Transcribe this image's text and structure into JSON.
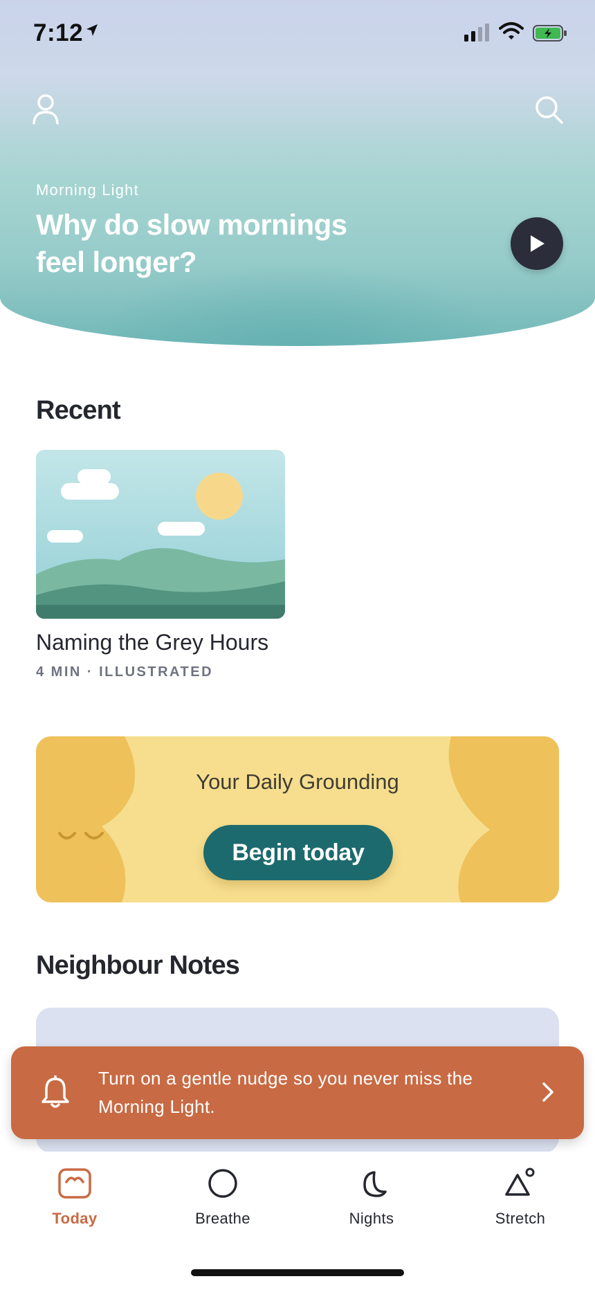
{
  "status_bar": {
    "time": "7:12"
  },
  "hero": {
    "eyebrow": "Morning Light",
    "title": "Why do slow mornings feel longer?"
  },
  "recent": {
    "section_title": "Recent",
    "card": {
      "title": "Naming the Grey Hours",
      "meta": "4 MIN · ILLUSTRATED"
    }
  },
  "grounding": {
    "title": "Your Daily Grounding",
    "button_label": "Begin today"
  },
  "neighbour_notes": {
    "section_title": "Neighbour Notes"
  },
  "nudge": {
    "text": "Turn on a gentle nudge so you never miss the Morning Light."
  },
  "tabs": [
    {
      "label": "Today",
      "icon": "today-icon",
      "active": true
    },
    {
      "label": "Breathe",
      "icon": "circle-icon",
      "active": false
    },
    {
      "label": "Nights",
      "icon": "moon-icon",
      "active": false
    },
    {
      "label": "Stretch",
      "icon": "triangle-icon",
      "active": false
    }
  ],
  "colors": {
    "accent": "#c86a43",
    "primary_button": "#1c6a6e",
    "grounding_bg": "#f6de8e",
    "notes_card": "#dce1f1"
  }
}
